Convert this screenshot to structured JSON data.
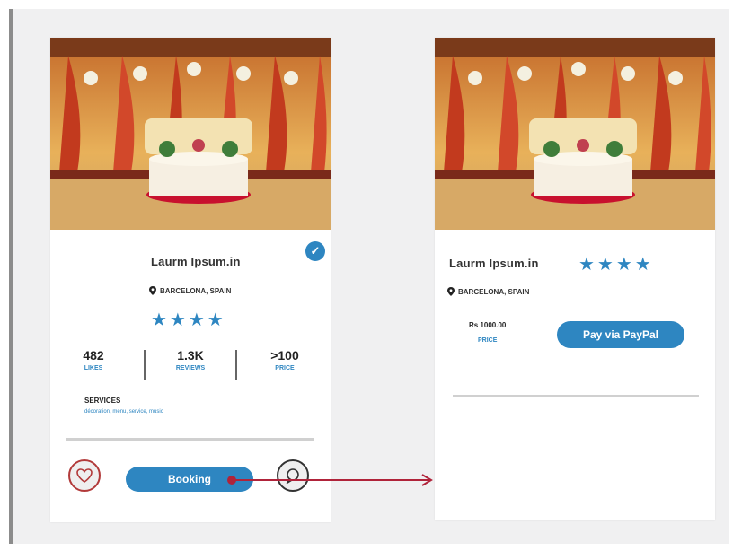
{
  "left_card": {
    "title": "Laurm Ipsum.in",
    "location": "BARCELONA, SPAIN",
    "rating_stars": "★★★★",
    "stats": [
      {
        "value": "482",
        "label": "LIKES"
      },
      {
        "value": "1.3K",
        "label": "REVIEWS"
      },
      {
        "value": ">100",
        "label": "PRICE"
      }
    ],
    "services_heading": "SERVICES",
    "services_text": "décoration, menu, service, music",
    "booking_label": "Booking",
    "verified_icon": "✓"
  },
  "right_card": {
    "title": "Laurm Ipsum.in",
    "location": "BARCELONA, SPAIN",
    "rating_stars": "★★★★",
    "price_value": "Rs 1000.00",
    "price_label": "PRICE",
    "paypal_label": "Pay via PayPal"
  },
  "colors": {
    "accent_blue": "#2e86c1",
    "arrow_red": "#b0233a",
    "heart_red": "#b23a3a"
  },
  "icons": [
    "location-pin-icon",
    "verified-check-icon",
    "heart-icon",
    "chat-icon",
    "star-icon",
    "arrow-right-icon"
  ]
}
